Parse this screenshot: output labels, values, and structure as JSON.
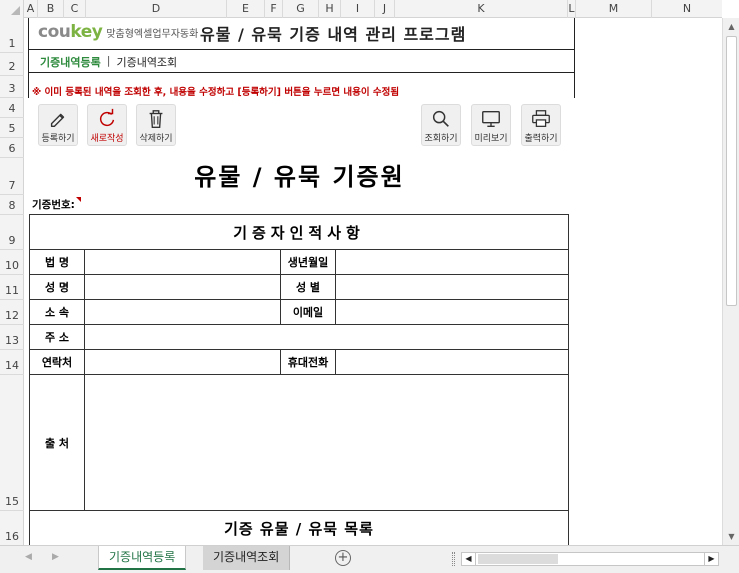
{
  "columns": [
    "A",
    "B",
    "C",
    "D",
    "E",
    "F",
    "G",
    "H",
    "I",
    "J",
    "K",
    "L",
    "M",
    "N"
  ],
  "rows": [
    "1",
    "2",
    "3",
    "4",
    "5",
    "6",
    "7",
    "8",
    "9",
    "10",
    "11",
    "12",
    "13",
    "14",
    "15",
    "16"
  ],
  "brand": {
    "logo_main": "cou",
    "logo_accent": "key",
    "tagline": "맞춤형엑셀업무자동화"
  },
  "app_title": "유물 / 유묵 기증 내역 관리 프로그램",
  "nav": {
    "active": "기증내역등록",
    "separator": "|",
    "other": "기증내역조회"
  },
  "notice": "※ 이미 등록된 내역을 조회한 후, 내용을 수정하고 [등록하기] 버튼을 누르면 내용이 수정됨",
  "buttons": {
    "register": "등록하기",
    "new": "새로작성",
    "delete": "삭제하기",
    "search": "조회하기",
    "preview": "미리보기",
    "print": "출력하기"
  },
  "form": {
    "title": "유물 / 유묵 기증원",
    "donation_no_label": "기증번호:",
    "section_donor": "기증자인적사항",
    "fields": {
      "corp_name": "법 명",
      "birthday": "생년월일",
      "name": "성 명",
      "gender": "성 별",
      "affiliation": "소 속",
      "email": "이메일",
      "address": "주 소",
      "contact": "연락처",
      "mobile": "휴대전화",
      "source": "출 처"
    },
    "section_items": "기증 유물 / 유묵 목록"
  },
  "sheet_tabs": [
    "기증내역등록",
    "기증내역조회"
  ],
  "colors": {
    "accent_green": "#217346",
    "logo_green": "#7cb342",
    "notice_red": "#c00000"
  }
}
